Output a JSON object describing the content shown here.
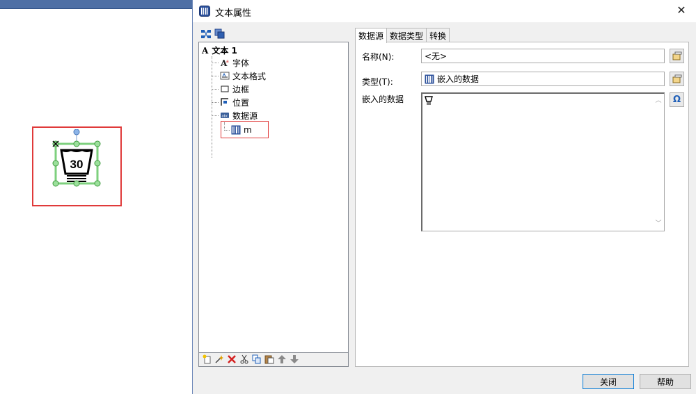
{
  "dialog": {
    "title": "文本属性",
    "close_glyph": "✕"
  },
  "tree": {
    "root_glyph": "A",
    "root_label": "文本 1",
    "items": [
      {
        "label": "字体",
        "icon": "font-icon"
      },
      {
        "label": "文本格式",
        "icon": "text-format-icon"
      },
      {
        "label": "边框",
        "icon": "border-icon"
      },
      {
        "label": "位置",
        "icon": "position-icon"
      },
      {
        "label": "数据源",
        "icon": "data-source-icon"
      }
    ],
    "child": {
      "label": "m",
      "icon": "barcode-data-icon"
    }
  },
  "tabs": [
    {
      "label": "数据源",
      "active": true
    },
    {
      "label": "数据类型",
      "active": false
    },
    {
      "label": "转换",
      "active": false
    }
  ],
  "form": {
    "name_label": "名称(N):",
    "name_value": "<无>",
    "type_label": "类型(T):",
    "type_value": "嵌入的数据",
    "embedded_label": "嵌入的数据",
    "embedded_value_icon": "wash-symbol-glyph",
    "omega_glyph": "Ω"
  },
  "buttons": {
    "close_label": "关闭",
    "help_label": "帮助"
  },
  "canvas": {
    "symbol_text": "30",
    "symbol_icon": "wash-30-icon"
  },
  "colors": {
    "highlight": "#e03a3a",
    "selection": "#7ed07e",
    "accent": "#0078d7"
  }
}
